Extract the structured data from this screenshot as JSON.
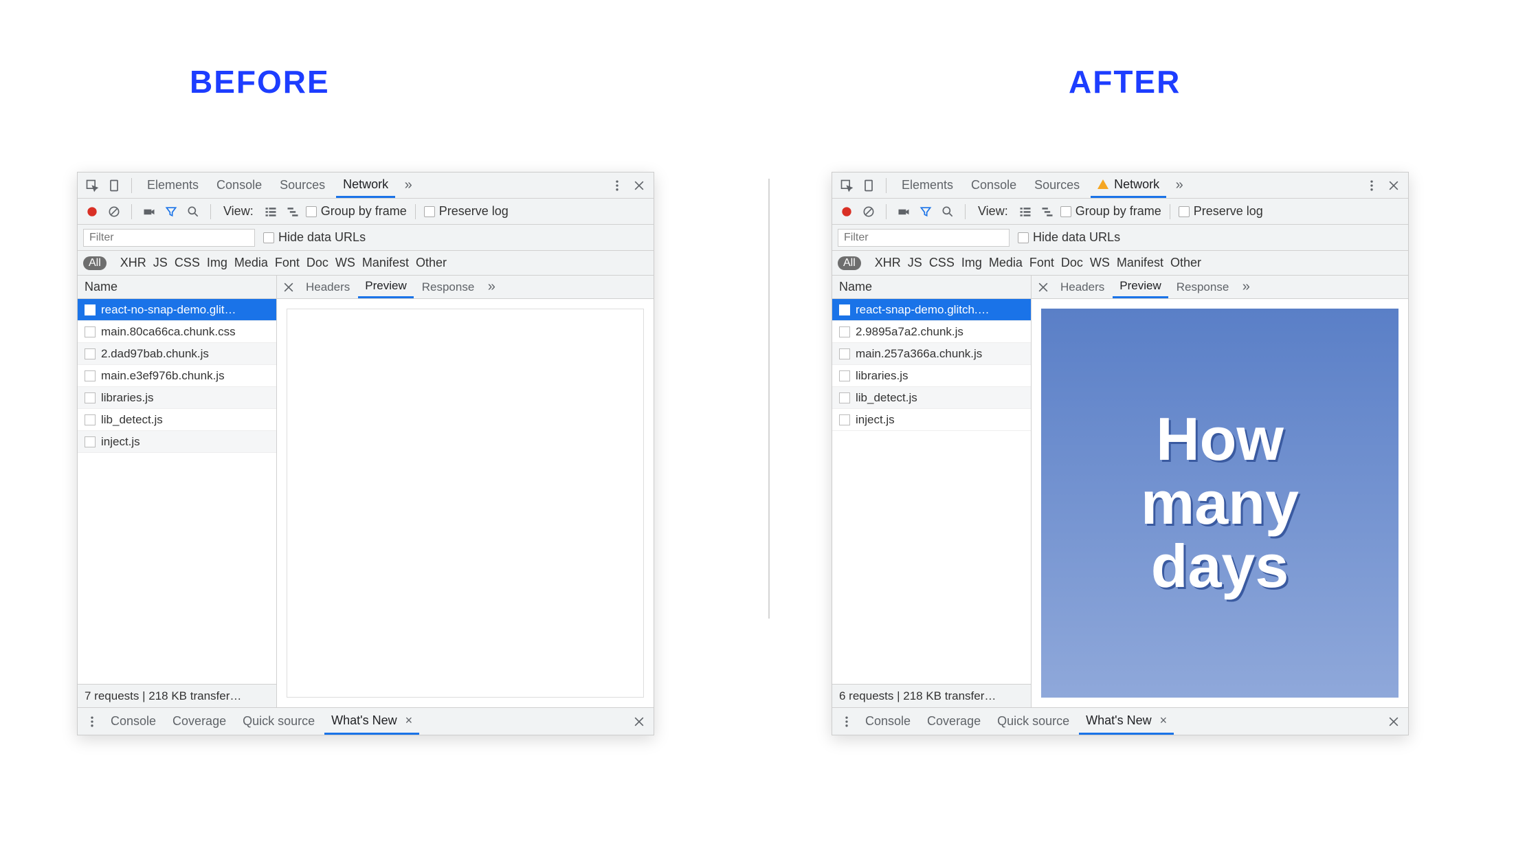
{
  "headings": {
    "before": "BEFORE",
    "after": "AFTER"
  },
  "main_tabs": {
    "elements": "Elements",
    "console": "Console",
    "sources": "Sources",
    "network": "Network"
  },
  "toolbar": {
    "view_label": "View:",
    "group_by_frame": "Group by frame",
    "preserve_log": "Preserve log"
  },
  "filter": {
    "placeholder": "Filter",
    "hide_data_urls": "Hide data URLs"
  },
  "types": {
    "all": "All",
    "xhr": "XHR",
    "js": "JS",
    "css": "CSS",
    "img": "Img",
    "media": "Media",
    "font": "Font",
    "doc": "Doc",
    "ws": "WS",
    "manifest": "Manifest",
    "other": "Other"
  },
  "columns": {
    "name": "Name"
  },
  "detail_tabs": {
    "headers": "Headers",
    "preview": "Preview",
    "response": "Response"
  },
  "drawer": {
    "console": "Console",
    "coverage": "Coverage",
    "quick_source": "Quick source",
    "whats_new": "What's New"
  },
  "before": {
    "requests": [
      "react-no-snap-demo.glit…",
      "main.80ca66ca.chunk.css",
      "2.dad97bab.chunk.js",
      "main.e3ef976b.chunk.js",
      "libraries.js",
      "lib_detect.js",
      "inject.js"
    ],
    "status": "7 requests | 218 KB transfer…",
    "has_warning": false,
    "preview_text": []
  },
  "after": {
    "requests": [
      "react-snap-demo.glitch.…",
      "2.9895a7a2.chunk.js",
      "main.257a366a.chunk.js",
      "libraries.js",
      "lib_detect.js",
      "inject.js"
    ],
    "status": "6 requests | 218 KB transfer…",
    "has_warning": true,
    "preview_text": [
      "How",
      "many",
      "days"
    ]
  }
}
